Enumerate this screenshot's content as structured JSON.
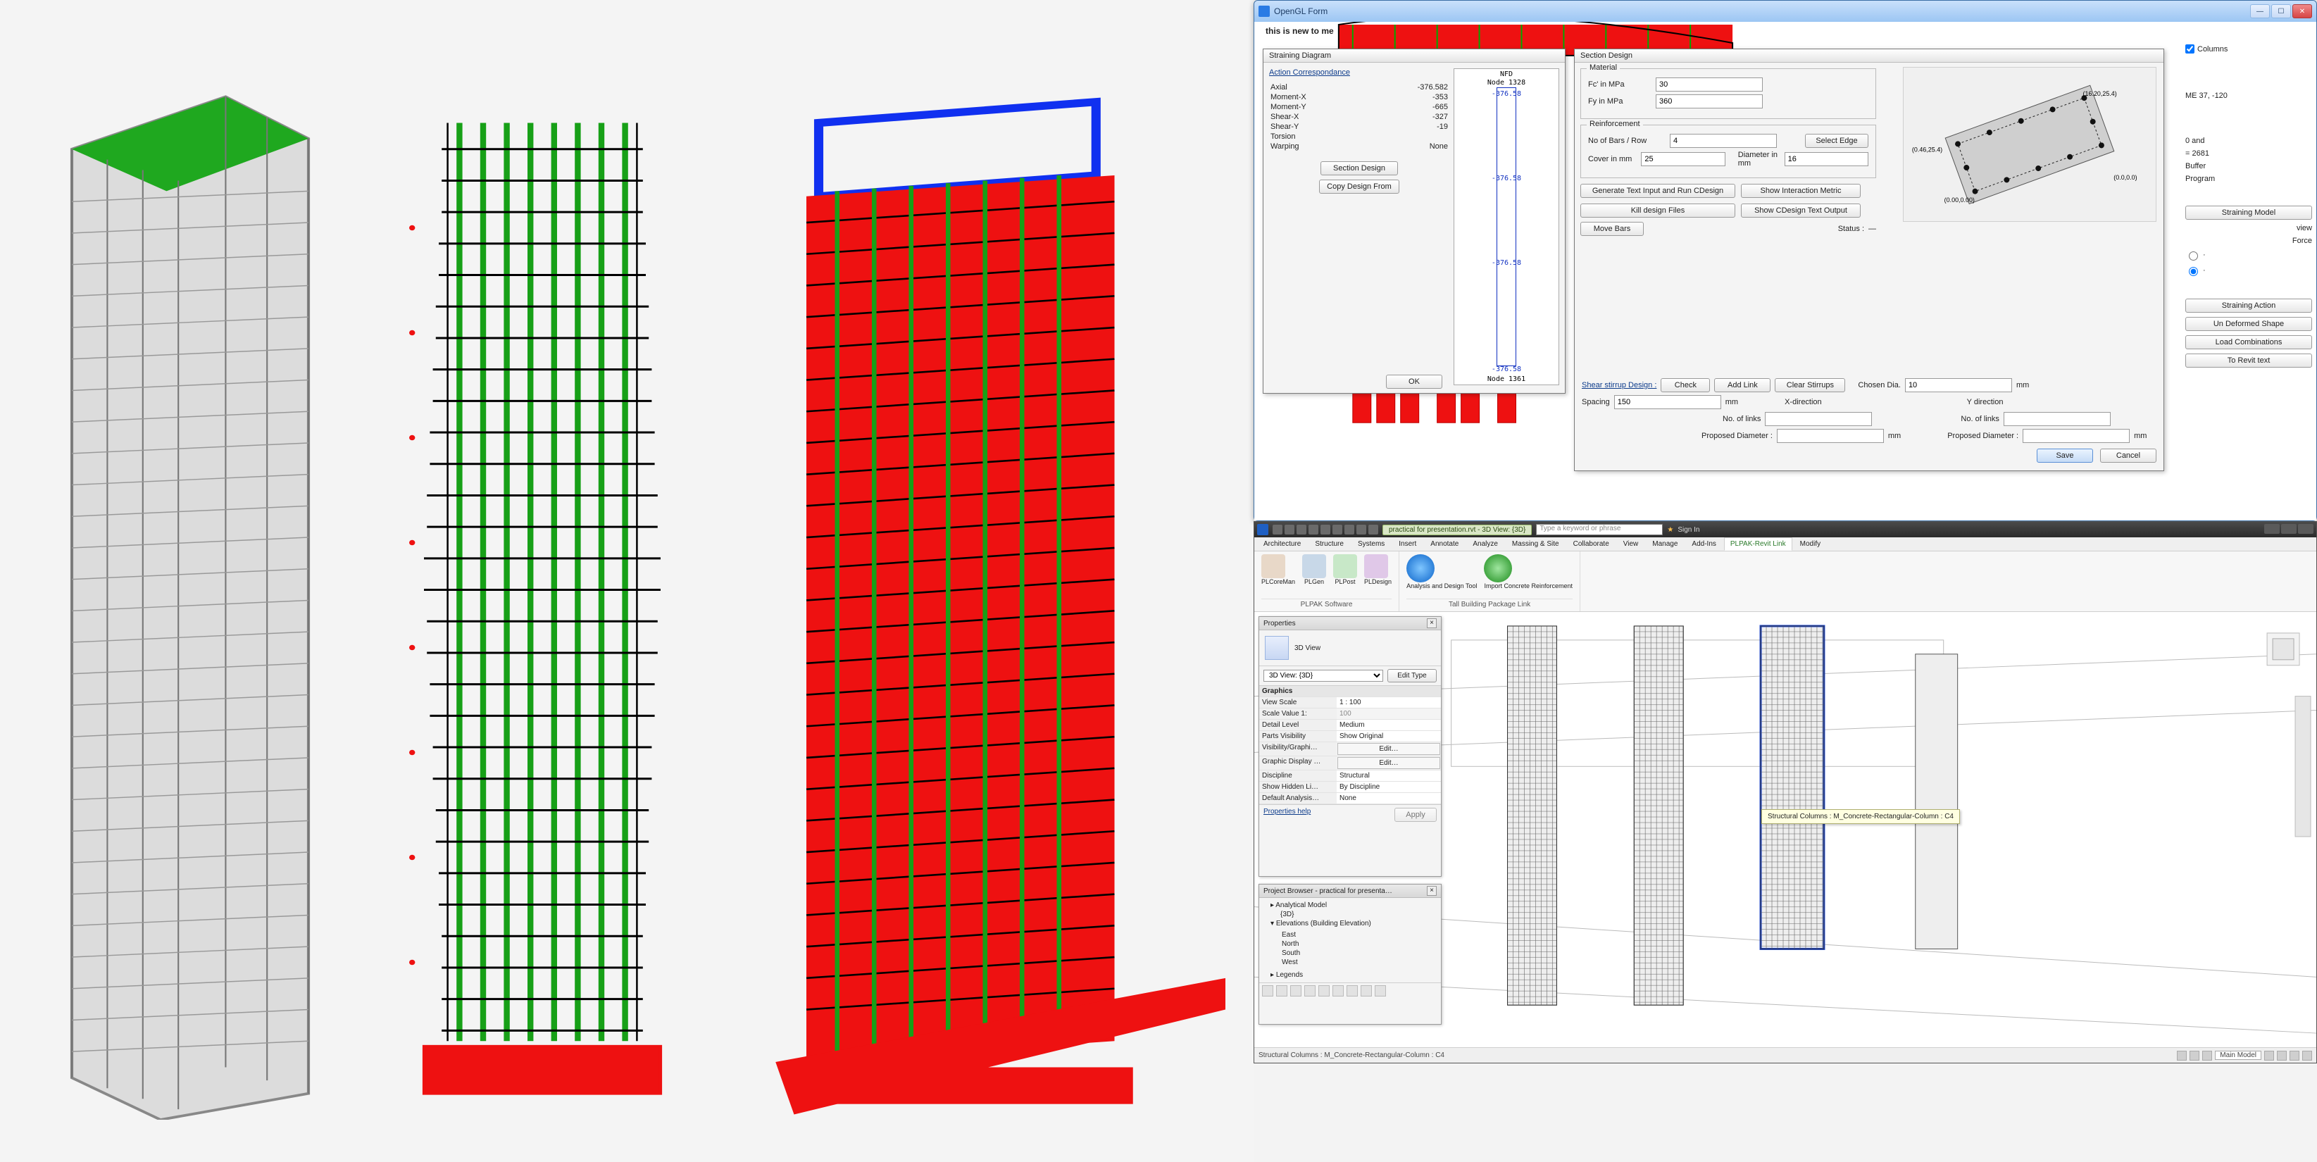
{
  "opengl": {
    "title": "OpenGL Form",
    "note": "this is new to me",
    "right_tools": {
      "columns_chk": "Columns",
      "me_label": "ME 37, -120",
      "text1": "0 and",
      "text2": "= 2681",
      "buffer": "Buffer",
      "program": "Program",
      "straining_model": "Straining Model",
      "view": "view",
      "force": "Force",
      "straining_action": "Straining Action",
      "undeformed": "Un Deformed Shape",
      "load_comb": "Load Combinations",
      "to_revit": "To Revit text"
    }
  },
  "strain": {
    "title": "Straining Diagram",
    "ac_title": "Action Correspondance",
    "rows": [
      [
        "Axial",
        "-376.582"
      ],
      [
        "Moment-X",
        "-353"
      ],
      [
        "Moment-Y",
        "-665"
      ],
      [
        "Shear-X",
        "-327"
      ],
      [
        "Shear-Y",
        "-19"
      ],
      [
        "Torsion",
        ""
      ],
      [
        "Warping",
        "None"
      ]
    ],
    "btn_section": "Section Design",
    "btn_copy": "Copy Design From",
    "btn_ok": "OK",
    "nfd_title": "NFD",
    "node_top": "Node 1328",
    "node_bot": "Node 1361",
    "val": "-376.58"
  },
  "secd": {
    "title": "Section Design",
    "material": "Material",
    "fc": "Fc' in MPa",
    "fc_v": "30",
    "fy": "Fy in MPa",
    "fy_v": "360",
    "reinf": "Reinforcement",
    "bars_row": "No of Bars / Row",
    "bars_row_v": "4",
    "select_edge": "Select Edge",
    "cover": "Cover in mm",
    "cover_v": "25",
    "diam": "Diameter in mm",
    "diam_v": "16",
    "gen": "Generate Text Input and Run CDesign",
    "show_im": "Show Interaction Metric",
    "kill": "Kill design Files",
    "show_out": "Show CDesign Text Output",
    "move": "Move Bars",
    "status_lbl": "Status :",
    "status_v": "—",
    "shear_title": "Shear stirrup Design :",
    "check": "Check",
    "addlink": "Add Link",
    "clear": "Clear Stirrups",
    "chosen": "Chosen Dia.",
    "chosen_v": "10",
    "mm": "mm",
    "spacing": "Spacing",
    "spacing_v": "150",
    "xdir": "X-direction",
    "ydir": "Y direction",
    "nolinks": "No. of links",
    "propdia": "Proposed Diameter :",
    "save": "Save",
    "cancel": "Cancel",
    "preview_labels": [
      "(0.00,0.00)",
      "(0.46,25.4)",
      "(16.20,25.4)",
      "(0.0,0.0)"
    ]
  },
  "revit": {
    "doc": "practical for presentation.rvt - 3D View: {3D}",
    "search_ph": "Type a keyword or phrase",
    "signin": "Sign In",
    "tabs": [
      "Architecture",
      "Structure",
      "Systems",
      "Insert",
      "Annotate",
      "Analyze",
      "Massing & Site",
      "Collaborate",
      "View",
      "Manage",
      "Add-Ins",
      "PLPAK-Revit Link",
      "Modify"
    ],
    "active_tab": 11,
    "panel1": {
      "labels": [
        "PLCoreMan",
        "PLGen",
        "PLPost",
        "PLDesign"
      ],
      "group": "PLPAK Software"
    },
    "panel2": {
      "labels": [
        "Analysis and Design Tool",
        "Import Concrete Reinforcement"
      ],
      "group": "Tall Building Package Link"
    },
    "status_left": "Structural Columns : M_Concrete-Rectangular-Column : C4",
    "status_model": "Main Model",
    "tooltip": "Structural Columns : M_Concrete-Rectangular-Column : C4"
  },
  "props": {
    "title": "Properties",
    "type": "3D View",
    "selector": "3D View: {3D}",
    "edit_type": "Edit Type",
    "section": "Graphics",
    "rows": [
      [
        "View Scale",
        "1 : 100",
        ""
      ],
      [
        "Scale Value  1:",
        "100",
        "ro"
      ],
      [
        "Detail Level",
        "Medium",
        ""
      ],
      [
        "Parts Visibility",
        "Show Original",
        ""
      ],
      [
        "Visibility/Graphi…",
        "Edit…",
        "btn"
      ],
      [
        "Graphic Display …",
        "Edit…",
        "btn"
      ],
      [
        "Discipline",
        "Structural",
        ""
      ],
      [
        "Show Hidden Li…",
        "By Discipline",
        ""
      ],
      [
        "Default Analysis…",
        "None",
        ""
      ]
    ],
    "help": "Properties help",
    "apply": "Apply"
  },
  "browser": {
    "title": "Project Browser - practical for presenta…",
    "nodes": {
      "am": "Analytical Model",
      "threed": "{3D}",
      "elev": "Elevations (Building Elevation)",
      "dirs": [
        "East",
        "North",
        "South",
        "West"
      ],
      "legends": "Legends"
    }
  }
}
